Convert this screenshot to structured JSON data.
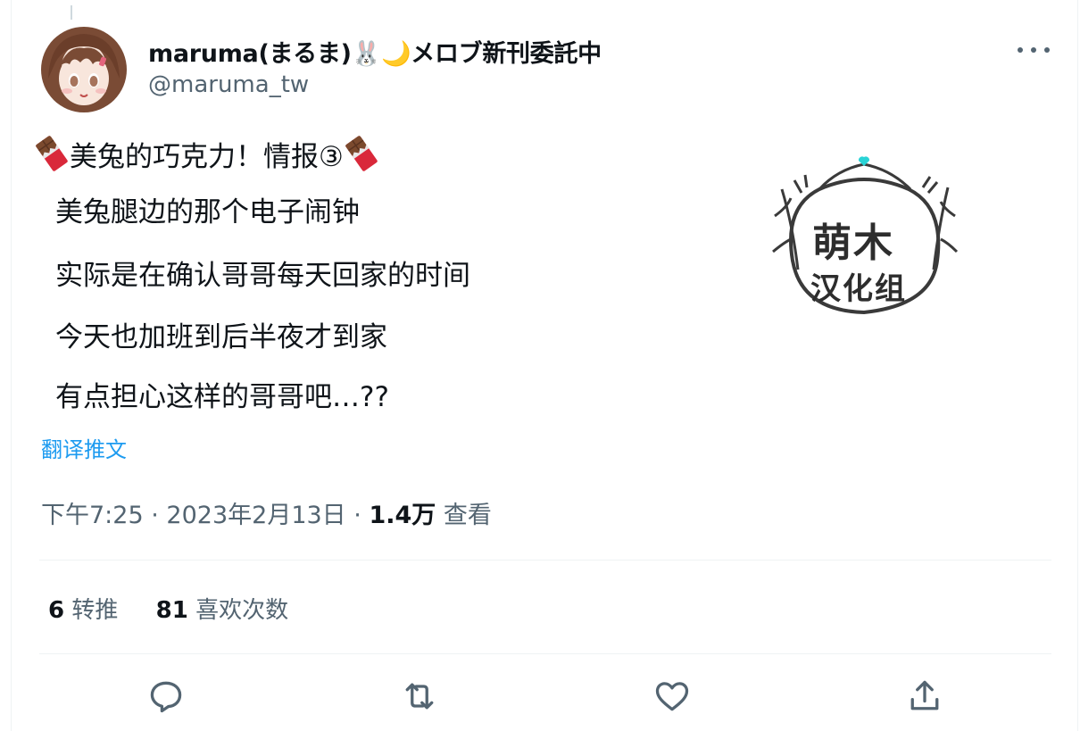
{
  "author": {
    "display_name": "maruma(まるま)🐰🌙メロブ新刊委託中",
    "handle": "@maruma_tw"
  },
  "tweet": {
    "title_line": "美兔的巧克力！情报③",
    "lines": [
      "美兔腿边的那个电子闹钟",
      "实际是在确认哥哥每天回家的时间",
      "今天也加班到后半夜才到家",
      "有点担心这样的哥哥吧…??"
    ]
  },
  "translate_label": "翻译推文",
  "meta": {
    "time": "下午7:25",
    "date": "2023年2月13日",
    "views_count": "1.4万",
    "views_label": "查看",
    "separator": "·"
  },
  "stats": {
    "retweets_count": "6",
    "retweets_label": "转推",
    "likes_count": "81",
    "likes_label": "喜欢次数"
  },
  "watermark": {
    "line1": "萌木",
    "line2": "汉化组"
  },
  "colors": {
    "text": "#0f1419",
    "secondary": "#536471",
    "link": "#1d9bf0",
    "divider": "#eff3f4"
  },
  "icons": {
    "more": "more-icon",
    "reply": "reply-icon",
    "retweet": "retweet-icon",
    "like": "heart-icon",
    "share": "share-icon",
    "emoji": "chocolate-bar-icon"
  }
}
